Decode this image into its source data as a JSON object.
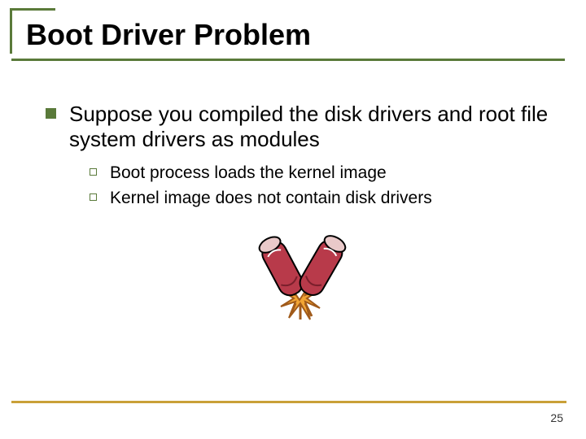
{
  "title": "Boot Driver Problem",
  "bullet": "Suppose you compiled the disk drivers and root file system drivers as modules",
  "subs": {
    "a": "Boot process loads the kernel image",
    "b": "Kernel image does not contain disk drivers"
  },
  "page": "25"
}
